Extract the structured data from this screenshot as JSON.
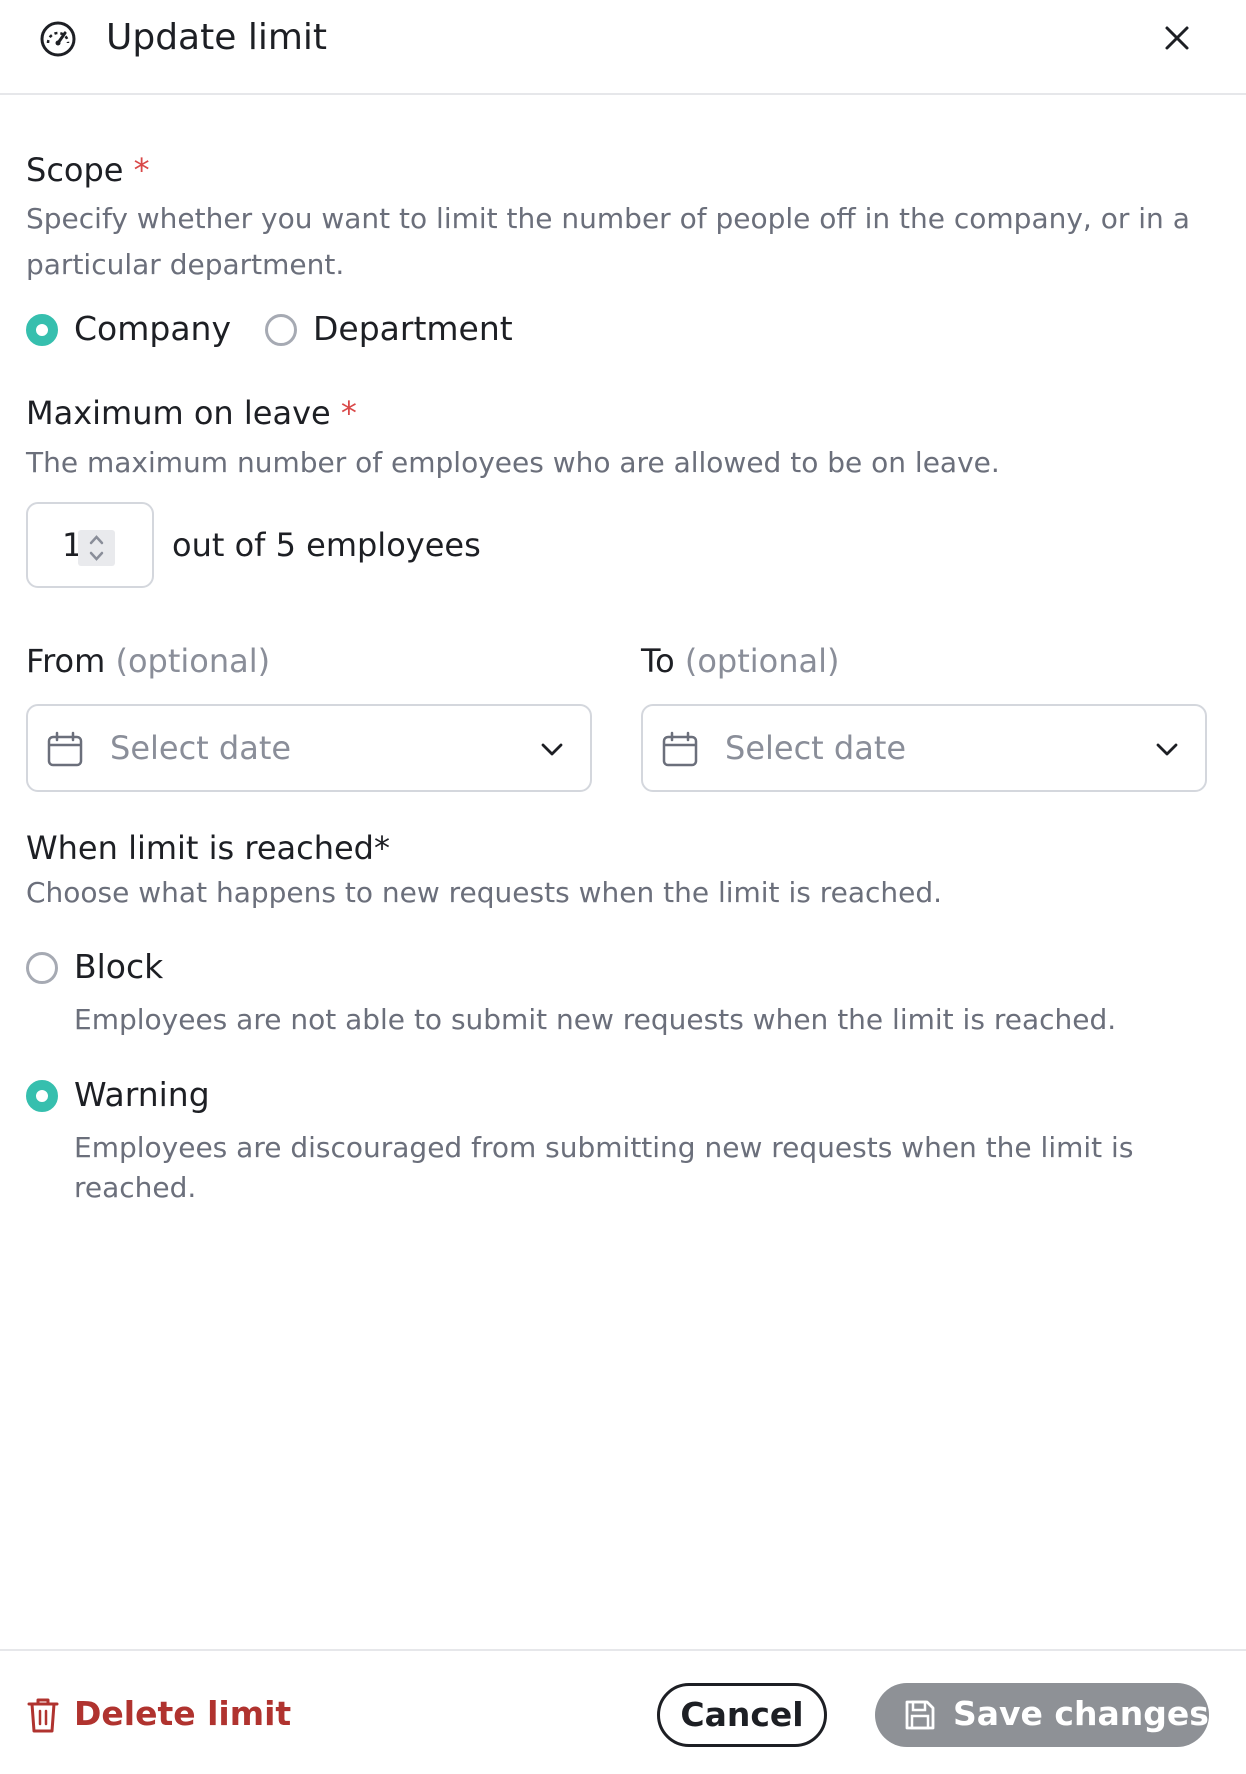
{
  "header": {
    "title": "Update limit",
    "icon": "gauge-icon",
    "close_icon": "close-icon"
  },
  "scope": {
    "label": "Scope",
    "required_mark": "*",
    "description": "Specify whether you want to limit the number of people off in the company, or in a particular department.",
    "options": [
      {
        "label": "Company",
        "selected": true
      },
      {
        "label": "Department",
        "selected": false
      }
    ]
  },
  "maximum": {
    "label": "Maximum on leave",
    "required_mark": "*",
    "description": "The maximum number of employees who are allowed to be on leave.",
    "value": "1",
    "suffix": "out of 5 employees"
  },
  "dates": {
    "from_label": "From",
    "to_label": "To",
    "optional": "(optional)",
    "from_placeholder": "Select date",
    "to_placeholder": "Select date"
  },
  "limit_reached": {
    "label": "When limit is reached",
    "required_mark": "*",
    "description": "Choose what happens to new requests when the limit is reached.",
    "options": [
      {
        "title": "Block",
        "description": "Employees are not able to submit new requests when the limit is reached.",
        "selected": false
      },
      {
        "title": "Warning",
        "description": "Employees are discouraged from submitting new requests when the limit is reached.",
        "selected": true
      }
    ]
  },
  "footer": {
    "delete_label": "Delete limit",
    "cancel_label": "Cancel",
    "save_label": "Save changes"
  },
  "colors": {
    "accent": "#36bfae",
    "danger": "#b0332f",
    "required": "#d94848",
    "disabled_button": "#8e9196"
  }
}
